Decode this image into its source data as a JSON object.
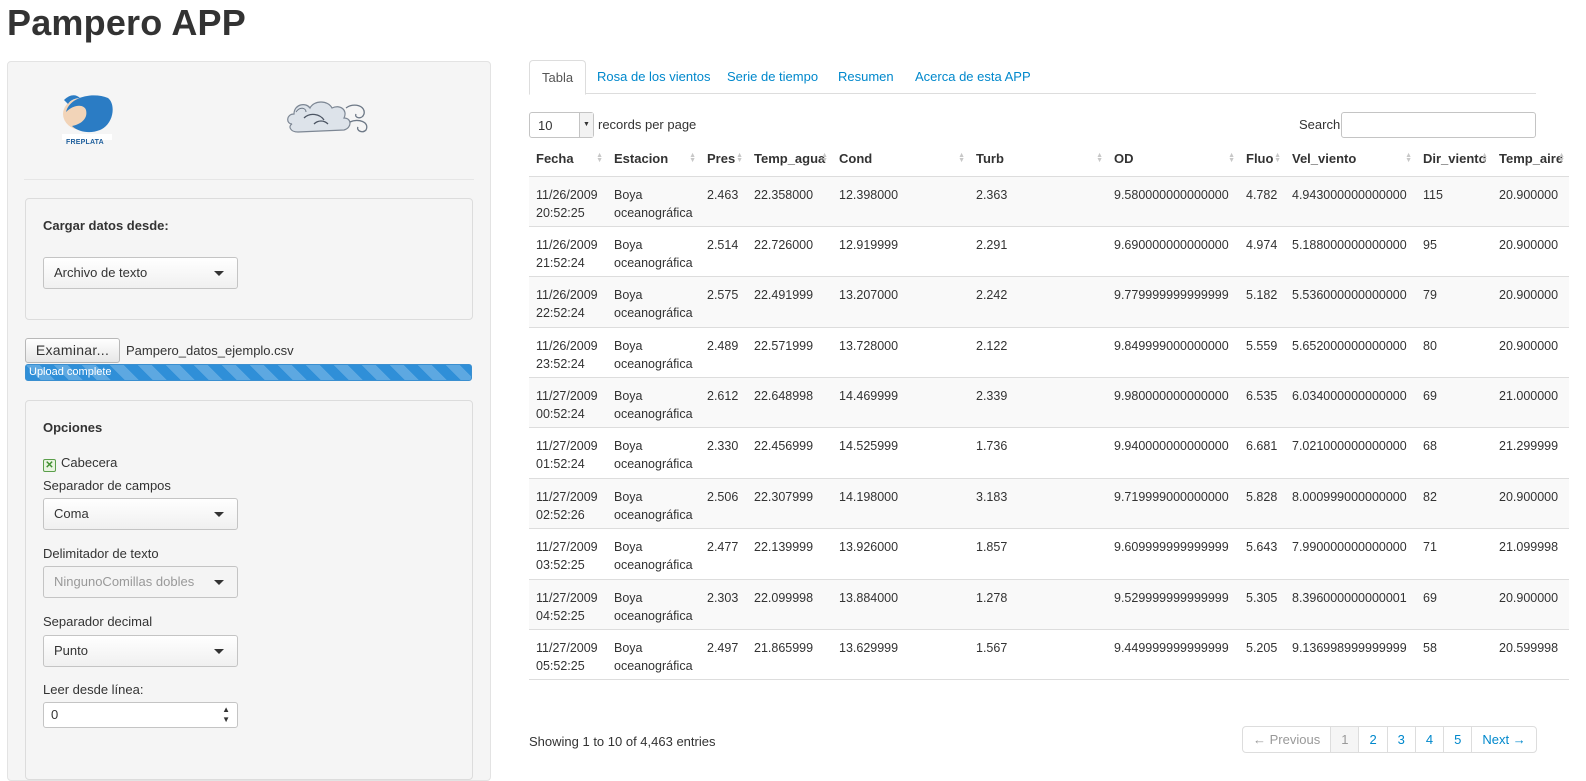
{
  "app": {
    "title": "Pampero APP"
  },
  "sidebar": {
    "logo_freplata_text": "FREPLATA",
    "load_section": {
      "title": "Cargar datos desde:",
      "source_select": "Archivo de texto"
    },
    "file": {
      "button_label": "Examinar...",
      "file_name": "Pampero_datos_ejemplo.csv",
      "progress_text": "Upload complete",
      "progress": 1.0
    },
    "options": {
      "title": "Opciones",
      "header_checkbox_label": "Cabecera",
      "header_checked": true,
      "field_sep_label": "Separador de campos",
      "field_sep_value": "Coma",
      "text_delim_label": "Delimitador de texto",
      "text_delim_value": "NingunoComillas dobles",
      "decimal_sep_label": "Separador decimal",
      "decimal_sep_value": "Punto",
      "skip_label": "Leer desde línea:",
      "skip_value": "0"
    }
  },
  "tabs": [
    {
      "label": "Tabla",
      "active": true
    },
    {
      "label": "Rosa de los vientos",
      "active": false
    },
    {
      "label": "Serie de tiempo",
      "active": false
    },
    {
      "label": "Resumen",
      "active": false
    },
    {
      "label": "Acerca de esta APP",
      "active": false
    }
  ],
  "table_controls": {
    "length_value": "10",
    "length_label": "records per page",
    "search_label": "Search:"
  },
  "table": {
    "columns": [
      "Fecha",
      "Estacion",
      "Pres",
      "Temp_agua",
      "Cond",
      "Turb",
      "OD",
      "Fluo",
      "Vel_viento",
      "Dir_viento",
      "Temp_aire"
    ],
    "rows": [
      [
        "11/26/2009 20:52:25",
        "Boya oceanográfica",
        "2.463",
        "22.358000",
        "12.398000",
        "2.363",
        "9.580000000000000",
        "4.782",
        "4.943000000000000",
        "115",
        "20.900000"
      ],
      [
        "11/26/2009 21:52:24",
        "Boya oceanográfica",
        "2.514",
        "22.726000",
        "12.919999",
        "2.291",
        "9.690000000000000",
        "4.974",
        "5.188000000000000",
        "95",
        "20.900000"
      ],
      [
        "11/26/2009 22:52:24",
        "Boya oceanográfica",
        "2.575",
        "22.491999",
        "13.207000",
        "2.242",
        "9.779999999999999",
        "5.182",
        "5.536000000000000",
        "79",
        "20.900000"
      ],
      [
        "11/26/2009 23:52:24",
        "Boya oceanográfica",
        "2.489",
        "22.571999",
        "13.728000",
        "2.122",
        "9.849999000000000",
        "5.559",
        "5.652000000000000",
        "80",
        "20.900000"
      ],
      [
        "11/27/2009 00:52:24",
        "Boya oceanográfica",
        "2.612",
        "22.648998",
        "14.469999",
        "2.339",
        "9.980000000000000",
        "6.535",
        "6.034000000000000",
        "69",
        "21.000000"
      ],
      [
        "11/27/2009 01:52:24",
        "Boya oceanográfica",
        "2.330",
        "22.456999",
        "14.525999",
        "1.736",
        "9.940000000000000",
        "6.681",
        "7.021000000000000",
        "68",
        "21.299999"
      ],
      [
        "11/27/2009 02:52:26",
        "Boya oceanográfica",
        "2.506",
        "22.307999",
        "14.198000",
        "3.183",
        "9.719999000000000",
        "5.828",
        "8.000999000000000",
        "82",
        "20.900000"
      ],
      [
        "11/27/2009 03:52:25",
        "Boya oceanográfica",
        "2.477",
        "22.139999",
        "13.926000",
        "1.857",
        "9.609999999999999",
        "5.643",
        "7.990000000000000",
        "71",
        "21.099998"
      ],
      [
        "11/27/2009 04:52:25",
        "Boya oceanográfica",
        "2.303",
        "22.099998",
        "13.884000",
        "1.278",
        "9.529999999999999",
        "5.305",
        "8.396000000000001",
        "69",
        "20.900000"
      ],
      [
        "11/27/2009 05:52:25",
        "Boya oceanográfica",
        "2.497",
        "21.865999",
        "13.629999",
        "1.567",
        "9.449999999999999",
        "5.205",
        "9.136998999999999",
        "58",
        "20.599998"
      ]
    ]
  },
  "footer": {
    "info": "Showing 1 to 10 of 4,463 entries",
    "pagination": {
      "previous": "← Previous",
      "pages": [
        "1",
        "2",
        "3",
        "4",
        "5"
      ],
      "current": "1",
      "next": "Next →"
    }
  },
  "colors": {
    "link": "#0088cc",
    "progress": "#2f8fd8",
    "well_bg": "#f5f5f5",
    "border": "#dddddd"
  },
  "icons": {
    "checkbox": "check-icon",
    "select": "caret-down-icon",
    "sort": "sort-icon"
  }
}
